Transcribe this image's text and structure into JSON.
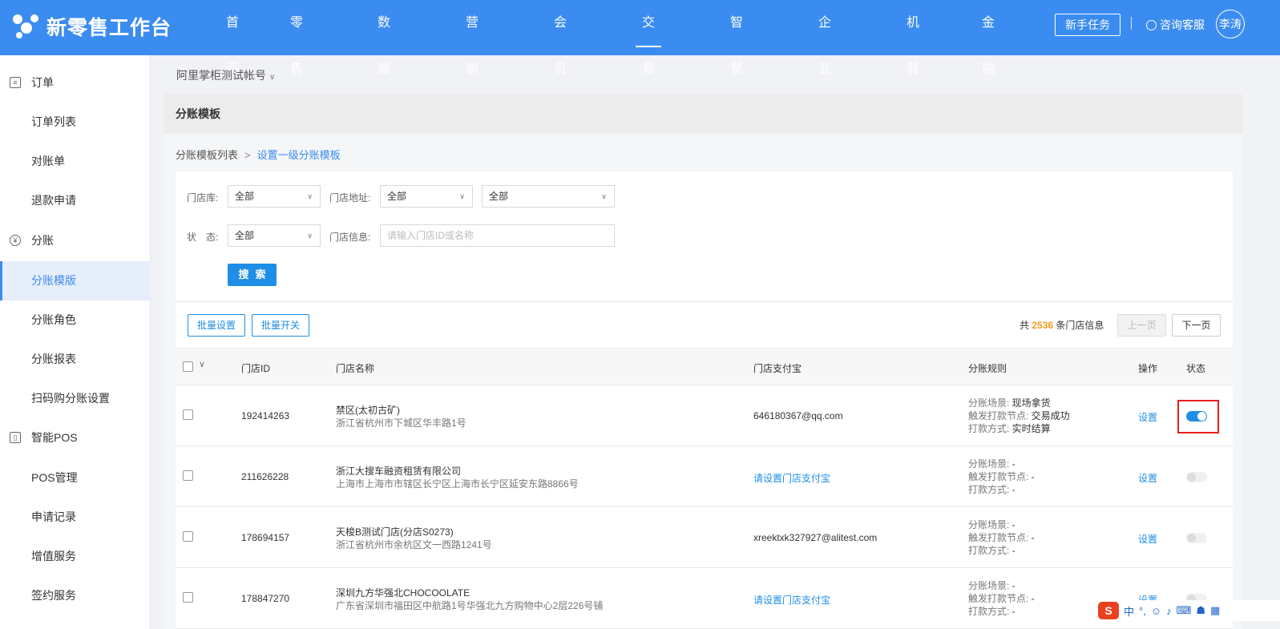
{
  "app": {
    "title": "新零售工作台"
  },
  "nav": {
    "items": [
      "首页",
      "零售管理",
      "数据中心",
      "营销中心",
      "会员中心",
      "交易中心",
      "智慧商圈",
      "企业管理",
      "机器人",
      "金融服务"
    ],
    "active": "交易中心",
    "newbie": "新手任务",
    "service": "咨询客服",
    "avatar": "李涛"
  },
  "sidebar": {
    "groups": [
      {
        "label": "订单",
        "icon": "document-icon",
        "items": [
          "订单列表",
          "对账单",
          "退款申请"
        ]
      },
      {
        "label": "分账",
        "icon": "yuan-icon",
        "items": [
          "分账模版",
          "分账角色",
          "分账报表",
          "扫码购分账设置"
        ]
      },
      {
        "label": "智能POS",
        "icon": "pos-icon",
        "items": [
          "POS管理",
          "申请记录",
          "增值服务",
          "签约服务"
        ]
      }
    ],
    "active": "分账模版"
  },
  "account": "阿里掌柜测试帐号",
  "panel": {
    "title": "分账模板"
  },
  "breadcrumb": {
    "parent": "分账模板列表",
    "current": "设置一级分账模板"
  },
  "filters": {
    "store_lib_label": "门店库:",
    "store_lib_value": "全部",
    "address_label": "门店地址:",
    "address_value_1": "全部",
    "address_value_2": "全部",
    "status_label": "状　态:",
    "status_value": "全部",
    "info_label": "门店信息:",
    "info_placeholder": "请输入门店ID或名称",
    "search_label": "搜索"
  },
  "toolbar": {
    "batch_set": "批量设置",
    "batch_switch": "批量开关",
    "total_prefix": "共",
    "total_count": "2536",
    "total_suffix": "条门店信息",
    "prev": "上一页",
    "next": "下一页"
  },
  "table": {
    "headers": {
      "id": "门店ID",
      "name": "门店名称",
      "alipay": "门店支付宝",
      "rule": "分账规则",
      "op": "操作",
      "status": "状态"
    },
    "rule_labels": {
      "scene": "分账场景: ",
      "trigger": "触发打款节点: ",
      "method": "打款方式: "
    },
    "rows": [
      {
        "id": "192414263",
        "name": "禁区(太初古矿)",
        "address": "浙江省杭州市下城区华丰路1号",
        "alipay": "646180367@qq.com",
        "scene": "现场拿货",
        "trigger": "交易成功",
        "method": "实时结算",
        "op": "设置",
        "status_on": true
      },
      {
        "id": "211626228",
        "name": "浙江大搜车融资租赁有限公司",
        "address": "上海市上海市市辖区长宁区上海市长宁区延安东路8866号",
        "alipay": "请设置门店支付宝",
        "scene": "-",
        "trigger": "-",
        "method": "-",
        "op": "设置",
        "status_on": false
      },
      {
        "id": "178694157",
        "name": "天梭B测试门店(分店S0273)",
        "address": "浙江省杭州市余杭区文一西路1241号",
        "alipay": "xreektxk327927@alitest.com",
        "scene": "-",
        "trigger": "-",
        "method": "-",
        "op": "设置",
        "status_on": false
      },
      {
        "id": "178847270",
        "name": "深圳九方华强北CHOCOOLATE",
        "address": "广东省深圳市福田区中航路1号华强北九方购物中心2层226号铺",
        "alipay": "请设置门店支付宝",
        "scene": "-",
        "trigger": "-",
        "method": "-",
        "op": "设置",
        "status_on": false
      }
    ]
  },
  "ime": {
    "logo": "S",
    "lang": "中"
  }
}
